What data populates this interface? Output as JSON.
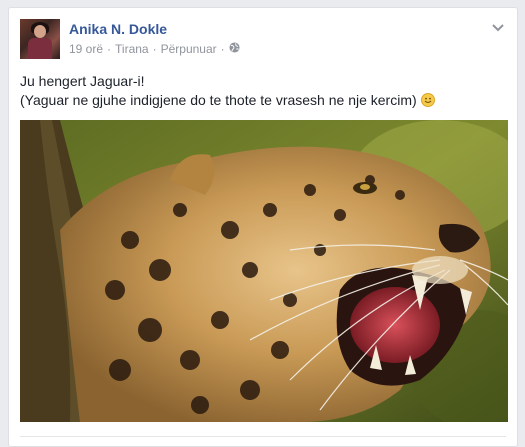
{
  "post": {
    "author_name": "Anika N. Dokle",
    "time": "19 orë",
    "location": "Tirana",
    "edited": "Përpunuar",
    "separator": "·",
    "text_line1": "Ju hengert Jaguar-i!",
    "text_line2": "(Yaguar ne gjuhe indigjene do te thote te vrasesh ne nje kercim)",
    "emoji": "smile-emoji",
    "photo_subject": "jaguar-photo"
  },
  "colors": {
    "link": "#365899",
    "meta": "#90949c",
    "text": "#1d2129",
    "background": "#e9ebee"
  }
}
